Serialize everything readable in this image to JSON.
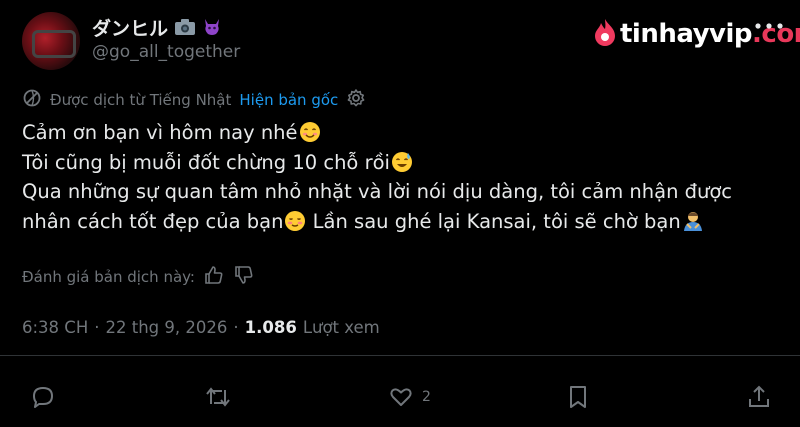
{
  "author": {
    "display_name": "ダンヒル",
    "handle": "@go_all_together"
  },
  "watermark": {
    "brand_main": "tinhayvip",
    "brand_suffix": ".com"
  },
  "translation": {
    "label": "Được dịch từ Tiếng Nhật",
    "show_original": "Hiện bản gốc"
  },
  "tweet": {
    "line1": "Cảm ơn bạn vì hôm nay nhé",
    "line2": "Tôi cũng bị muỗi đốt chừng 10 chỗ rồi",
    "line3": "Qua những sự quan tâm nhỏ nhặt và lời nói dịu dàng, tôi cảm nhận được",
    "line4a": "nhân cách tốt đẹp của bạn",
    "line4b": " Lần sau ghé lại Kansai, tôi sẽ chờ bạn"
  },
  "rate_translation": {
    "label": "Đánh giá bản dịch này:"
  },
  "meta": {
    "time": "6:38 CH",
    "date": "22 thg 9, 2026",
    "views_count": "1.086",
    "views_label": "Lượt xem",
    "dot": "·"
  },
  "actions": {
    "like_count": "2"
  },
  "colors": {
    "background": "#000000",
    "text": "#e7e9ea",
    "muted": "#71767b",
    "link": "#1d9bf0",
    "brand_accent": "#e8385a"
  }
}
